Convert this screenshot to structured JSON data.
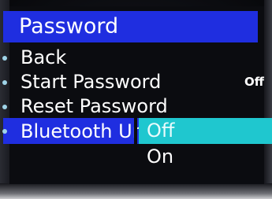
{
  "screen": {
    "title": "Password"
  },
  "menu": {
    "items": [
      {
        "label": "Back",
        "value": ""
      },
      {
        "label": "Start Password",
        "value": "Off"
      },
      {
        "label": "Reset Password",
        "value": ""
      },
      {
        "label": "Bluetooth Ur",
        "value": ""
      }
    ]
  },
  "dropdown": {
    "options": [
      {
        "label": "Off",
        "selected": true
      },
      {
        "label": "On",
        "selected": false
      }
    ]
  },
  "colors": {
    "title_bar": "#1f2ee0",
    "selected_option": "#1fc7cf",
    "highlight_row": "#1f2ee0",
    "bullet": "#9fd3e8"
  }
}
